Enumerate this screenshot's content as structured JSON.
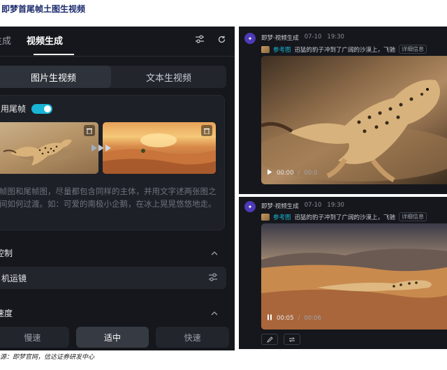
{
  "page": {
    "heading": "即梦首尾帧土图生视频",
    "source": "源：即梦官网，信达证券研发中心"
  },
  "left": {
    "tabs": [
      "生成",
      "视频生成"
    ],
    "icons": [
      "sliders-icon",
      "refresh-icon"
    ],
    "mode_tabs": [
      "图片生视频",
      "文本生视频"
    ],
    "first_last_toggle_label": "用尾帧",
    "first_last_toggle_on": true,
    "prompt_placeholder": "帧图和尾帧图，尽量都包含同样的主体，并用文字述两张图之间如何过渡。如：可爱的南极小企鹅，在冰上晃晃悠悠地走。",
    "camera_section": "控制",
    "camera_label": "机运镜",
    "speed_section": "速度",
    "speed_options": [
      "慢速",
      "适中",
      "快速"
    ],
    "speed_selected": "适中"
  },
  "results": [
    {
      "bot_name": "即梦·视频生成",
      "date": "07-10",
      "time": "19:30",
      "ref_label": "参考图",
      "prompt": "迅猛的豹子冲到了广阔的沙漠上，飞驰",
      "detail": "详细信息",
      "current_time": "00:00",
      "duration": "00:0",
      "playing": false
    },
    {
      "bot_name": "即梦·视频生成",
      "date": "07-10",
      "time": "19:30",
      "ref_label": "参考图",
      "prompt": "迅猛的豹子冲到了广阔的沙漠上，飞驰",
      "detail": "详细信息",
      "current_time": "00:05",
      "duration": "00:06",
      "playing": true
    }
  ],
  "colors": {
    "panel_bg": "#15171c",
    "accent": "#19b4d6",
    "bot_icon": "#4c3ab8"
  }
}
